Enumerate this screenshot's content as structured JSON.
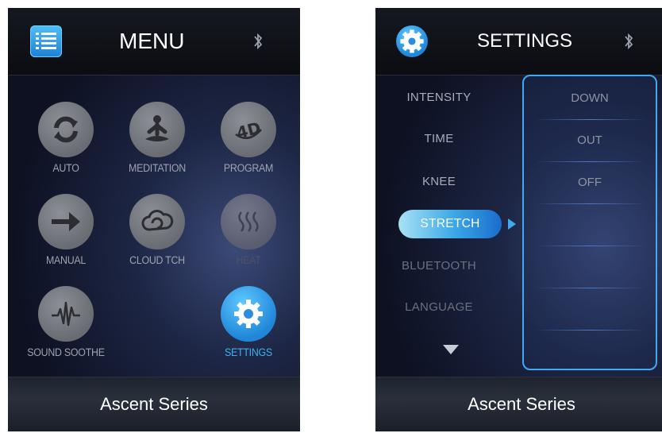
{
  "menu_screen": {
    "title": "MENU",
    "footer": "Ascent Series",
    "tiles": [
      {
        "label": "AUTO",
        "icon": "refresh-icon"
      },
      {
        "label": "MEDITATION",
        "icon": "meditation-icon"
      },
      {
        "label": "PROGRAM",
        "icon": "4d-icon"
      },
      {
        "label": "MANUAL",
        "icon": "arrow-right-icon"
      },
      {
        "label": "CLOUD TCH",
        "icon": "cloud-touch-icon"
      },
      {
        "label": "HEAT",
        "icon": "heat-icon"
      },
      {
        "label": "SOUND SOOTHE",
        "icon": "sound-wave-icon"
      },
      {
        "label": "SETTINGS",
        "icon": "gear-icon"
      }
    ]
  },
  "settings_screen": {
    "title": "SETTINGS",
    "footer": "Ascent Series",
    "options": [
      {
        "label": "INTENSITY"
      },
      {
        "label": "TIME"
      },
      {
        "label": "KNEE"
      },
      {
        "label": "STRETCH",
        "selected": true
      },
      {
        "label": "BLUETOOTH"
      },
      {
        "label": "LANGUAGE"
      }
    ],
    "values": [
      "DOWN",
      "OUT",
      "OFF"
    ]
  },
  "colors": {
    "accent": "#3fb1f2",
    "panel_border": "#41a9f0",
    "background": "#1d2645"
  }
}
